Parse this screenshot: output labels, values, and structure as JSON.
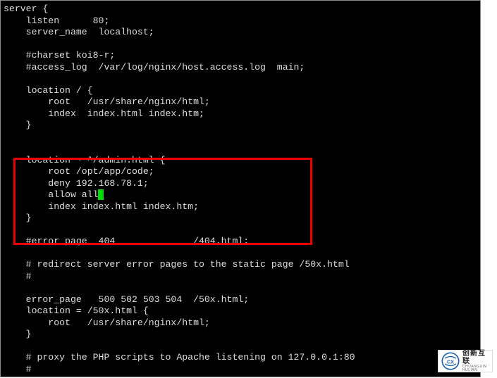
{
  "config": {
    "line01": "server {",
    "line02": "    listen      80;",
    "line03": "    server_name  localhost;",
    "line04": "",
    "line05": "    #charset koi8-r;",
    "line06": "    #access_log  /var/log/nginx/host.access.log  main;",
    "line07": "",
    "line08": "    location / {",
    "line09": "        root   /usr/share/nginx/html;",
    "line10": "        index  index.html index.htm;",
    "line11": "    }",
    "line12": "",
    "line13": "",
    "line14": "    location ~ ^/admin.html {",
    "line15": "        root /opt/app/code;",
    "line16": "        deny 192.168.78.1;",
    "line17a": "        allow all",
    "line17b": "",
    "line18": "        index index.html index.htm;",
    "line19": "    }",
    "line20": "",
    "line21": "    #error_page  404              /404.html;",
    "line22": "",
    "line23": "    # redirect server error pages to the static page /50x.html",
    "line24": "    #",
    "line25": "",
    "line26": "    error_page   500 502 503 504  /50x.html;",
    "line27": "    location = /50x.html {",
    "line28": "        root   /usr/share/nginx/html;",
    "line29": "    }",
    "line30": "",
    "line31": "    # proxy the PHP scripts to Apache listening on 127.0.0.1:80",
    "line32": "    #"
  },
  "logo": {
    "cn": "创新互联",
    "en": "CHUANGXIN HULIAN"
  }
}
